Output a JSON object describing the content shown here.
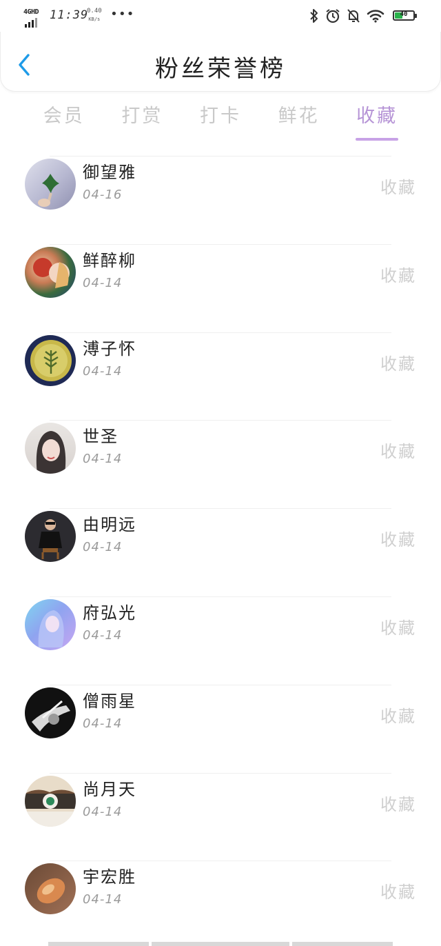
{
  "status_bar": {
    "network": "4GHD",
    "time": "11:39",
    "speed_value": "0.40",
    "speed_unit": "KB/s",
    "more": "•••",
    "battery": "40"
  },
  "header": {
    "title": "粉丝荣誉榜"
  },
  "tabs": [
    {
      "label": "会员"
    },
    {
      "label": "打赏"
    },
    {
      "label": "打卡"
    },
    {
      "label": "鲜花"
    },
    {
      "label": "收藏"
    }
  ],
  "active_tab": "收藏",
  "colors": {
    "accent": "#c7a2e6",
    "tab_active": "#b694d6",
    "tab_inactive": "#c9c9c9",
    "back_icon": "#1e9be8"
  },
  "fans": [
    {
      "name": "御望雅",
      "date": "04-16",
      "action": "收藏"
    },
    {
      "name": "鲜醉柳",
      "date": "04-14",
      "action": "收藏"
    },
    {
      "name": "溥子怀",
      "date": "04-14",
      "action": "收藏"
    },
    {
      "name": "世圣",
      "date": "04-14",
      "action": "收藏"
    },
    {
      "name": "由明远",
      "date": "04-14",
      "action": "收藏"
    },
    {
      "name": "府弘光",
      "date": "04-14",
      "action": "收藏"
    },
    {
      "name": "僧雨星",
      "date": "04-14",
      "action": "收藏"
    },
    {
      "name": "尚月天",
      "date": "04-14",
      "action": "收藏"
    },
    {
      "name": "宇宏胜",
      "date": "04-14",
      "action": "收藏"
    }
  ]
}
